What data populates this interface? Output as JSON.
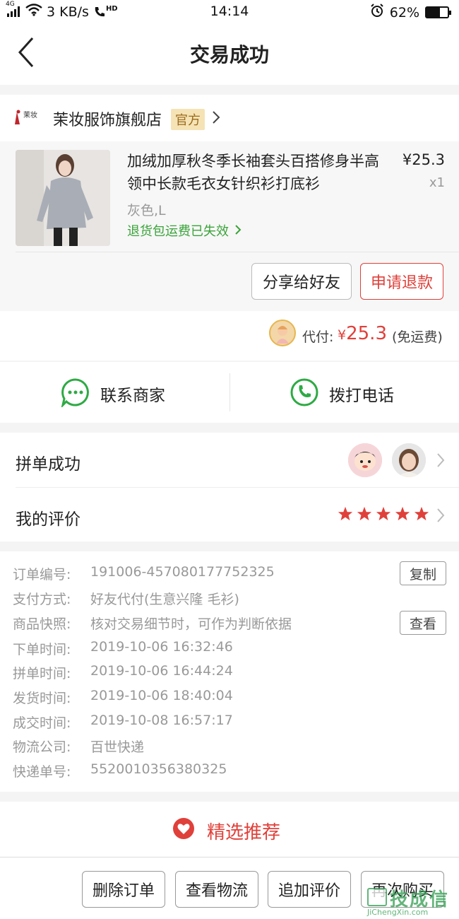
{
  "status_bar": {
    "network": "4G",
    "speed": "3 KB/s",
    "hd": "HD",
    "time": "14:14",
    "battery": "62%",
    "battery_level": 0.62
  },
  "nav": {
    "title": "交易成功"
  },
  "shop": {
    "logo_text": "茉妆",
    "name": "茉妆服饰旗舰店",
    "badge": "官方"
  },
  "item": {
    "title": "加绒加厚秋冬季长袖套头百搭修身半高领中长款毛衣女针织衫打底衫",
    "price": "¥25.3",
    "qty": "x1",
    "spec": "灰色,L",
    "notice": "退货包运费已失效",
    "share_button": "分享给好友",
    "refund_button": "申请退款"
  },
  "payment": {
    "label": "代付:",
    "currency": "¥",
    "amount": "25.3",
    "shipping": "(免运费)"
  },
  "contact": {
    "merchant": "联系商家",
    "phone": "拨打电话"
  },
  "group": {
    "label": "拼单成功",
    "review_label": "我的评价",
    "stars": 5
  },
  "order_info": {
    "rows": [
      {
        "key": "订单编号:",
        "value": "191006-457080177752325"
      },
      {
        "key": "支付方式:",
        "value": "好友代付(生意兴隆 毛衫)"
      },
      {
        "key": "商品快照:",
        "value": "核对交易细节时，可作为判断依据"
      },
      {
        "key": "下单时间:",
        "value": "2019-10-06 16:32:46"
      },
      {
        "key": "拼单时间:",
        "value": "2019-10-06 16:44:24"
      },
      {
        "key": "发货时间:",
        "value": "2019-10-06 18:40:04"
      },
      {
        "key": "成交时间:",
        "value": "2019-10-08 16:57:17"
      },
      {
        "key": "物流公司:",
        "value": "百世快递"
      },
      {
        "key": "快递单号:",
        "value": "5520010356380325"
      }
    ],
    "copy_button": "复制",
    "view_button": "查看"
  },
  "recommend": {
    "title": "精选推荐"
  },
  "bottom_bar": {
    "delete": "删除订单",
    "logistics": "查看物流",
    "add_review": "追加评价",
    "rebuy": "再次购买"
  },
  "watermark": {
    "text": "JiChengXin.com"
  },
  "colors": {
    "accent_red": "#e0403a",
    "green": "#3aa33a",
    "badge_bg": "#f5e3b6"
  }
}
